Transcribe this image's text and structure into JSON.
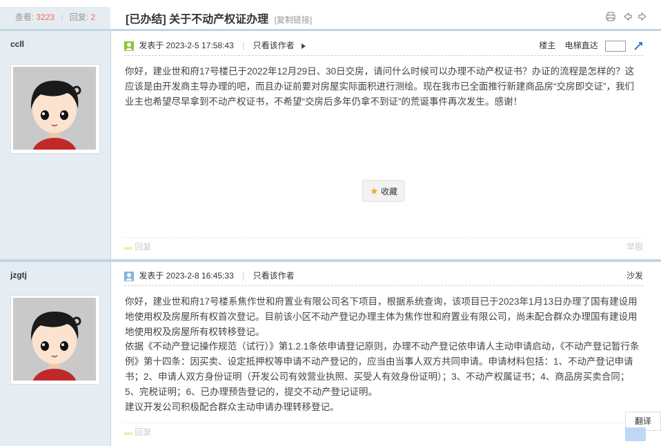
{
  "header": {
    "views_label": "查看:",
    "views": "3223",
    "replies_label": "回复:",
    "replies": "2",
    "title": "[已办结] 关于不动产权证办理",
    "copy_link": "[复制链接]"
  },
  "posts": [
    {
      "author": "ccll",
      "posted_label": "发表于 2023-2-5 17:58:43",
      "only_author": "只看该作者",
      "floor": "楼主",
      "elevator": "电梯直达",
      "body": "你好，建业世和府17号楼已于2022年12月29日、30日交房，请问什么时候可以办理不动产权证书？办证的流程是怎样的？这应该是由开发商主导办理的吧，而且办证前要对房屋实际面积进行测绘。现在我市已全面推行新建商品房“交房即交证”，我们业主也希望尽早拿到不动产权证书，不希望“交房后多年仍拿不到证”的荒诞事件再次发生。感谢！",
      "favorite": "收藏",
      "reply": "回复",
      "report": "举报"
    },
    {
      "author": "jzgtj",
      "posted_label": "发表于 2023-2-8 16:45:33",
      "only_author": "只看该作者",
      "floor": "沙发",
      "body_lines": [
        "你好，建业世和府17号楼系焦作世和府置业有限公司名下项目，根据系统查询，该项目已于2023年1月13日办理了国有建设用地使用权及房屋所有权首次登记。目前该小区不动产登记办理主体为焦作世和府置业有限公司，尚未配合群众办理国有建设用地使用权及房屋所有权转移登记。",
        "依据《不动产登记操作规范（试行）》第1.2.1条依申请登记原则，办理不动产登记依申请人主动申请启动，《不动产登记暂行条例》第十四条：因买卖、设定抵押权等申请不动产登记的，应当由当事人双方共同申请。申请材料包括：1、不动产登记申请书；2、申请人双方身份证明（开发公司有效营业执照、买受人有效身份证明）；3、不动产权属证书；4、商品房买卖合同；5、完税证明；6、已办理预告登记的，提交不动产登记证明。",
        "建议开发公司积极配合群众主动申请办理转移登记。"
      ],
      "reply": "回复"
    }
  ],
  "translate": "翻译",
  "colors": {
    "accent": "#c2d5e3",
    "sidebar": "#e5edf2",
    "views": "#f26c4f"
  }
}
